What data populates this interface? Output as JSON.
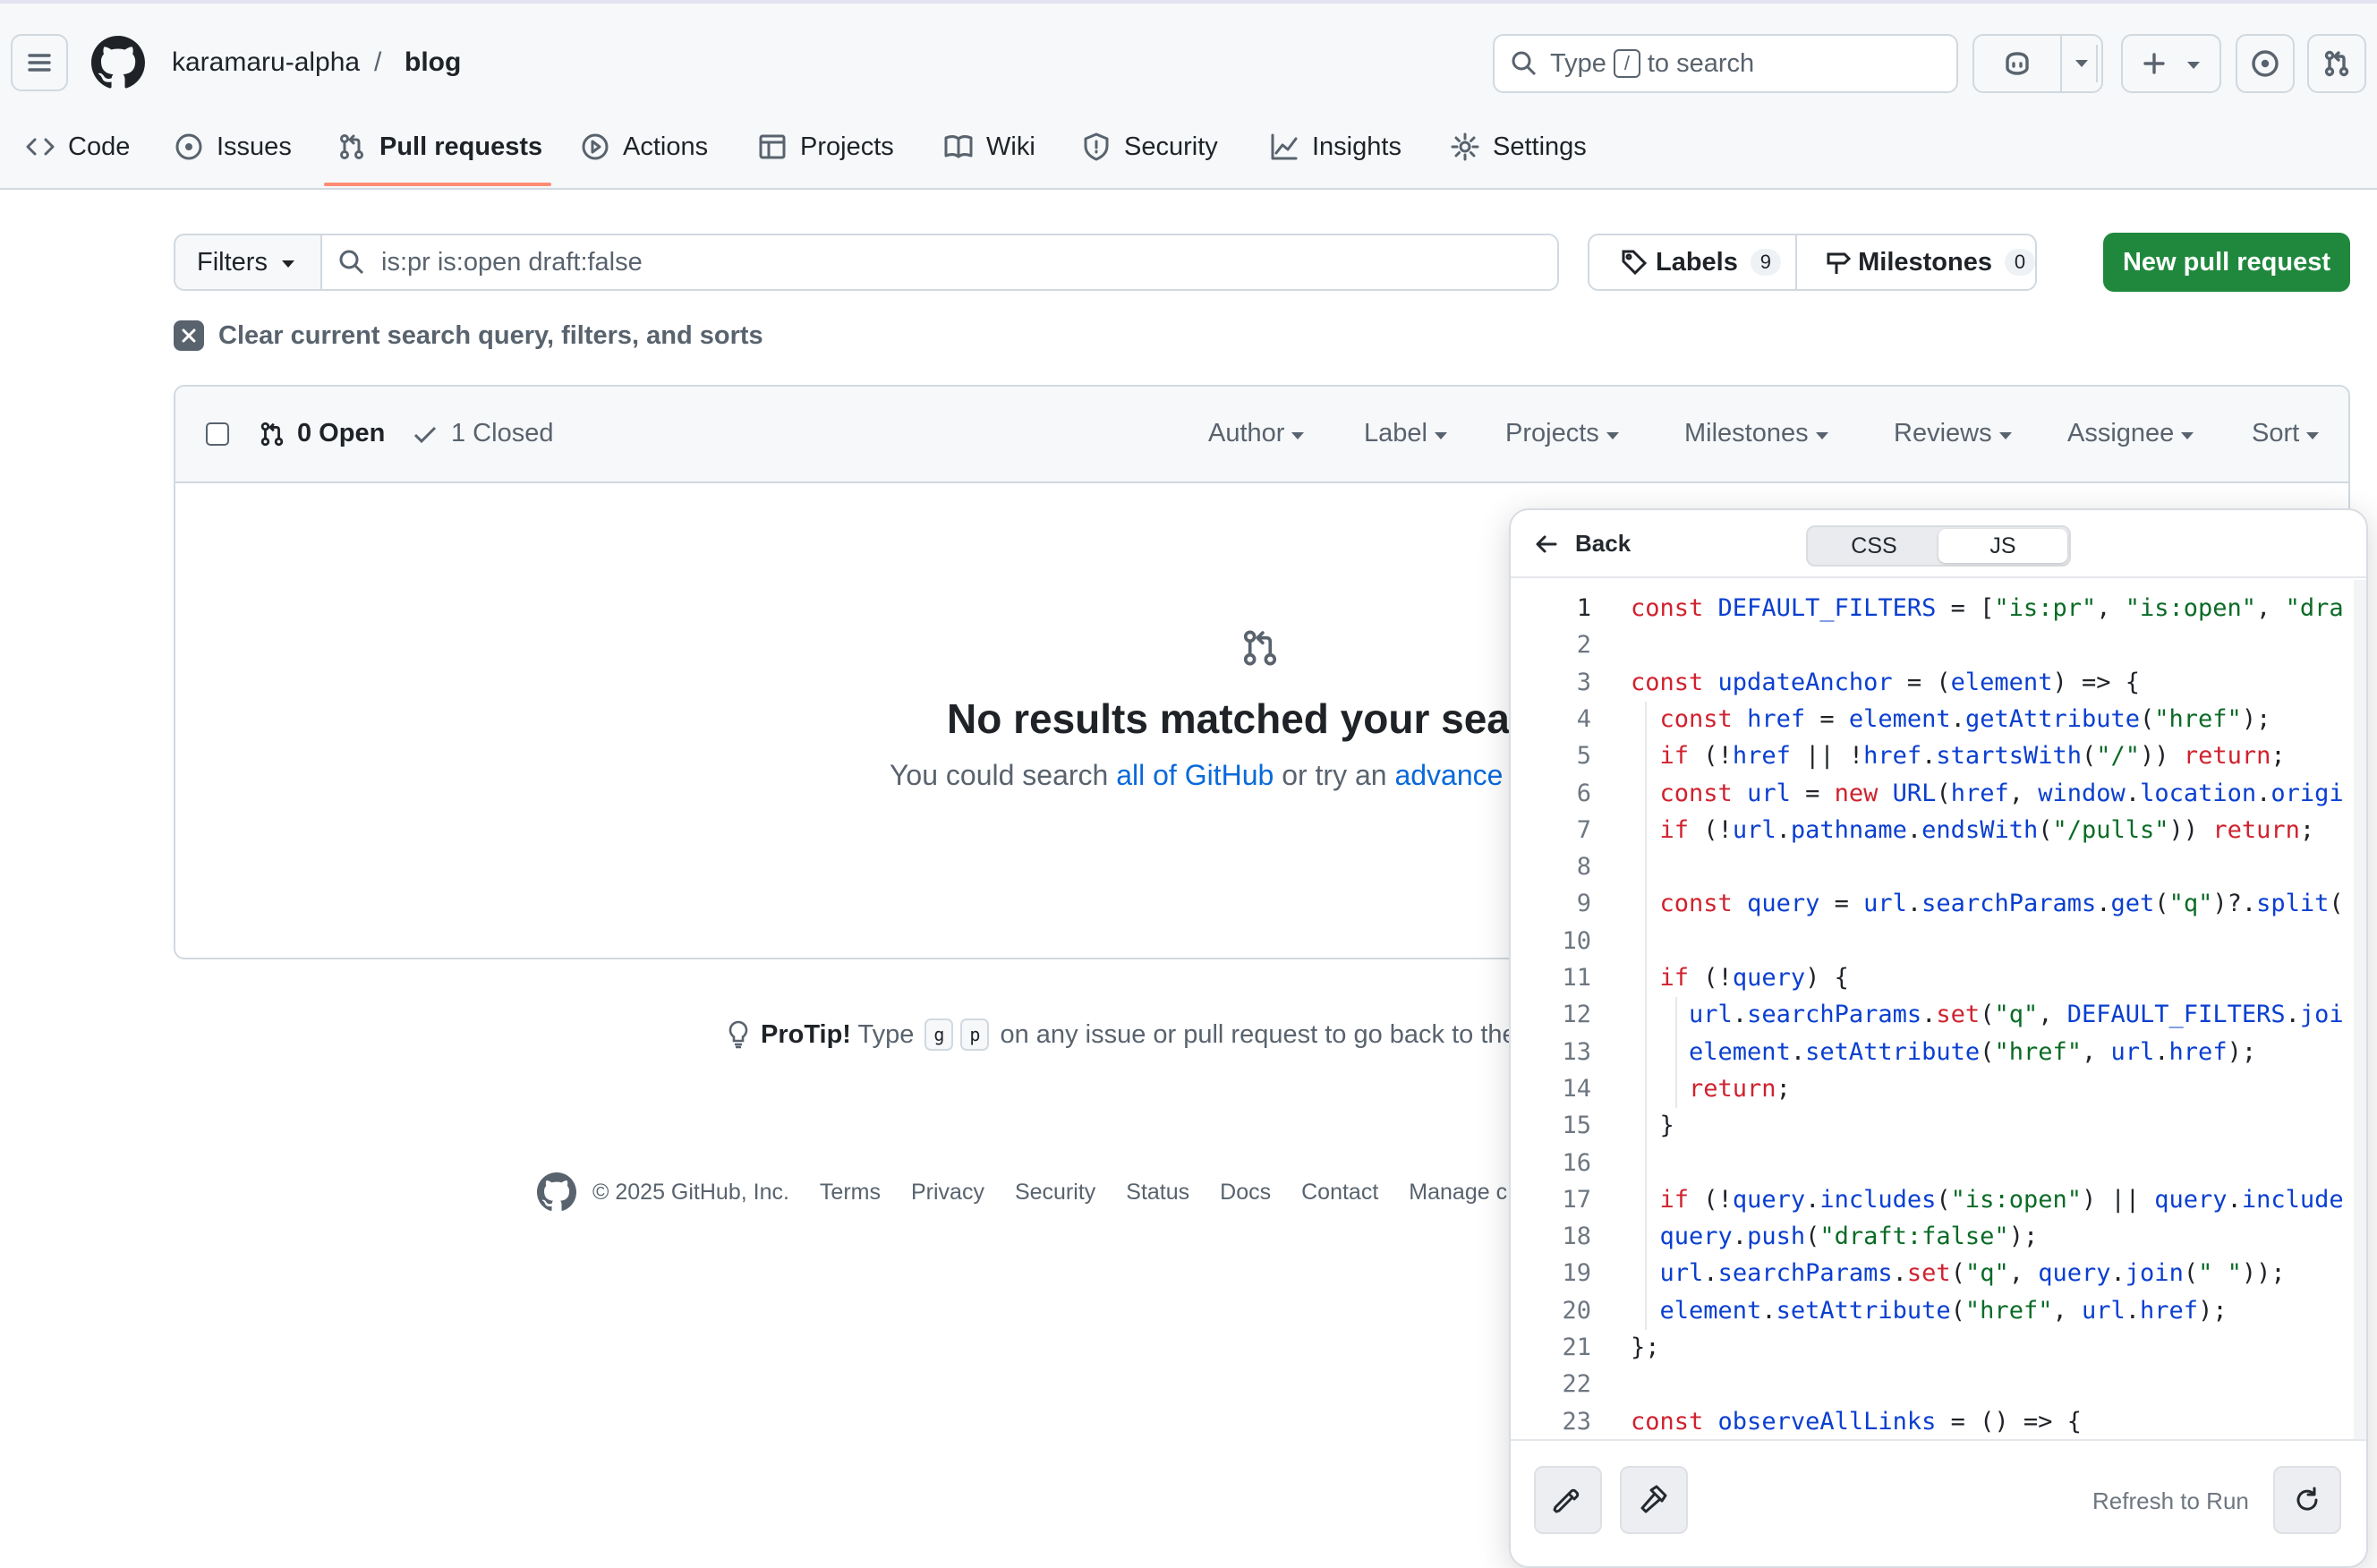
{
  "header": {
    "owner": "karamaru-alpha",
    "separator": "/",
    "repo": "blog",
    "search_prefix": "Type",
    "search_key": "/",
    "search_suffix": "to search"
  },
  "tabs": [
    {
      "label": "Code",
      "icon": "code-icon"
    },
    {
      "label": "Issues",
      "icon": "issue-icon"
    },
    {
      "label": "Pull requests",
      "icon": "pull-request-icon",
      "active": true
    },
    {
      "label": "Actions",
      "icon": "play-icon"
    },
    {
      "label": "Projects",
      "icon": "table-icon"
    },
    {
      "label": "Wiki",
      "icon": "book-icon"
    },
    {
      "label": "Security",
      "icon": "shield-icon"
    },
    {
      "label": "Insights",
      "icon": "graph-icon"
    },
    {
      "label": "Settings",
      "icon": "gear-icon"
    }
  ],
  "filter_bar": {
    "filters_label": "Filters",
    "query": "is:pr is:open draft:false",
    "labels_label": "Labels",
    "labels_count": "9",
    "milestones_label": "Milestones",
    "milestones_count": "0",
    "new_pr_label": "New pull request",
    "clear_label": "Clear current search query, filters, and sorts"
  },
  "list_header": {
    "open_label": "0 Open",
    "closed_label": "1 Closed",
    "filters": [
      "Author",
      "Label",
      "Projects",
      "Milestones",
      "Reviews",
      "Assignee",
      "Sort"
    ]
  },
  "empty_state": {
    "title": "No results matched your sear",
    "sub_prefix": "You could search ",
    "sub_link1": "all of GitHub",
    "sub_middle": " or try an ",
    "sub_link2": "advance"
  },
  "protip": {
    "bold": "ProTip!",
    "prefix": " Type ",
    "key1": "g",
    "key2": "p",
    "suffix": " on any issue or pull request to go back to the"
  },
  "footer": {
    "copyright": "© 2025 GitHub, Inc.",
    "links": [
      "Terms",
      "Privacy",
      "Security",
      "Status",
      "Docs",
      "Contact",
      "Manage c"
    ]
  },
  "code_panel": {
    "back_label": "Back",
    "tab_css": "CSS",
    "tab_js": "JS",
    "active_tab": "JS",
    "refresh_label": "Refresh to Run",
    "lines": [
      "const DEFAULT_FILTERS = [\"is:pr\", \"is:open\", \"dra",
      "",
      "const updateAnchor = (element) => {",
      "  const href = element.getAttribute(\"href\");",
      "  if (!href || !href.startsWith(\"/\")) return;",
      "  const url = new URL(href, window.location.origi",
      "  if (!url.pathname.endsWith(\"/pulls\")) return;",
      "",
      "  const query = url.searchParams.get(\"q\")?.split(",
      "",
      "  if (!query) {",
      "    url.searchParams.set(\"q\", DEFAULT_FILTERS.joi",
      "    element.setAttribute(\"href\", url.href);",
      "    return;",
      "  }",
      "",
      "  if (!query.includes(\"is:open\") || query.include",
      "  query.push(\"draft:false\");",
      "  url.searchParams.set(\"q\", query.join(\" \"));",
      "  element.setAttribute(\"href\", url.href);",
      "};",
      "",
      "const observeAllLinks = () => {"
    ]
  },
  "colors": {
    "accent_underline": "#fd8c73",
    "primary_button": "#1f883d",
    "link": "#0969da",
    "keyword": "#cf222e",
    "identifier": "#0a3fd0",
    "string": "#0a6b26"
  }
}
